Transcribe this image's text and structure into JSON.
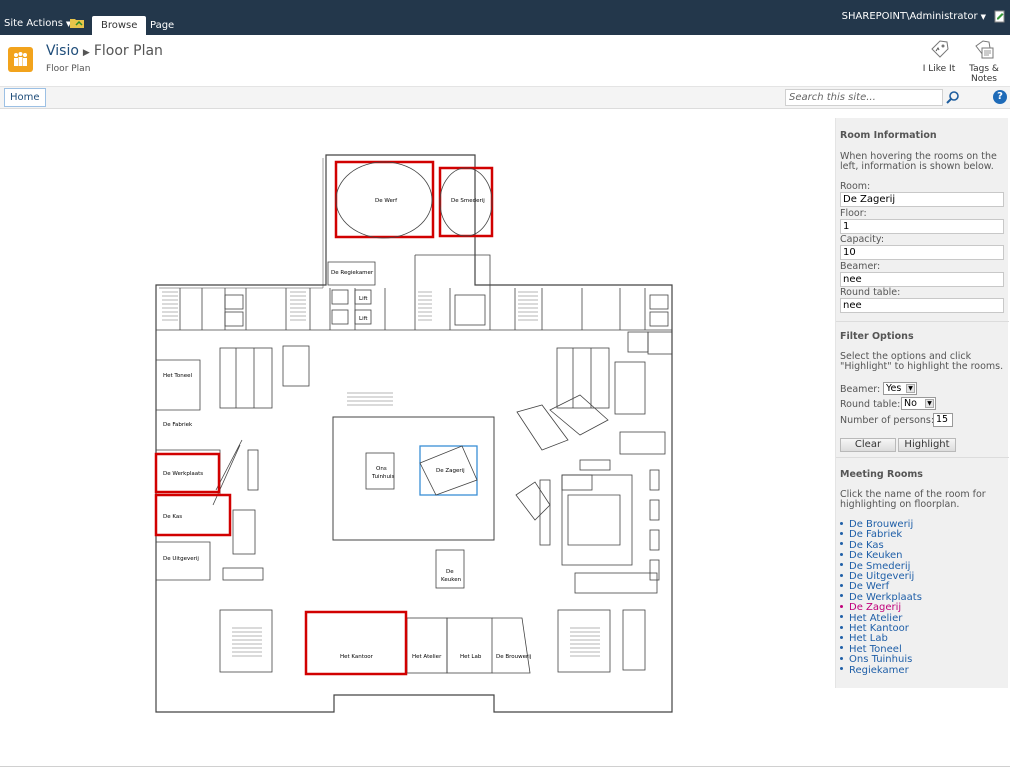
{
  "topbar": {
    "site_actions": "Site Actions",
    "tabs": [
      "Browse",
      "Page"
    ],
    "user": "SHAREPOINT\\Administrator"
  },
  "title": {
    "breadcrumb_root": "Visio",
    "breadcrumb_page": "Floor Plan",
    "subtitle": "Floor Plan",
    "i_like_it": "I Like It",
    "tags_notes": "Tags & Notes"
  },
  "nav": {
    "home": "Home",
    "search_placeholder": "Search this site..."
  },
  "floorplan": {
    "labels": {
      "werf": "De Werf",
      "smederij": "De Smederij",
      "regiekamer": "De Regiekamer",
      "toneel": "Het Toneel",
      "fabriek": "De Fabriek",
      "werkplaats": "De Werkplaats",
      "kas": "De Kas",
      "uitgeverij_a": "De Uitgeverij",
      "tuinhuis_a": "Ons",
      "tuinhuis_b": "Tuinhuis",
      "zagerij": "De Zagerij",
      "keuken_a": "De",
      "keuken_b": "Keuken",
      "kantoor": "Het Kantoor",
      "atelier": "Het Atelier",
      "lab": "Het Lab",
      "brouwerij": "De Brouwerij",
      "lift": "Lift"
    },
    "colors": {
      "highlight": "#d10000",
      "selected": "#3a8fd6",
      "wall": "#444444"
    }
  },
  "panel": {
    "room_info_title": "Room Information",
    "room_info_text": [
      "When hovering the rooms on the",
      "left, information is shown below."
    ],
    "room_label": "Room:",
    "room_value": "De Zagerij",
    "floor_label": "Floor:",
    "floor_value": "1",
    "capacity_label": "Capacity:",
    "capacity_value": "10",
    "beamer_label": "Beamer:",
    "beamer_value": "nee",
    "round_table_label": "Round table:",
    "round_table_value": "nee",
    "filter_title": "Filter Options",
    "filter_text": [
      "Select the options and click",
      "\"Highlight\" to highlight the rooms."
    ],
    "filter_beamer_label": "Beamer:",
    "filter_beamer_value": "Yes",
    "filter_round_label": "Round table:",
    "filter_round_value": "No",
    "filter_persons_label": "Number of persons:",
    "filter_persons_value": "15",
    "clear": "Clear",
    "highlight": "Highlight",
    "meeting_title": "Meeting Rooms",
    "meeting_text": [
      "Click the name of the room for",
      "highlighting on floorplan."
    ],
    "rooms": [
      "De Brouwerij",
      "De Fabriek",
      "De Kas",
      "De Keuken",
      "De Smederij",
      "De Uitgeverij",
      "De Werf",
      "De Werkplaats",
      "De Zagerij",
      "Het Atelier",
      "Het Kantoor",
      "Het Lab",
      "Het Toneel",
      "Ons Tuinhuis",
      "Regiekamer"
    ],
    "active_room_index": 8
  }
}
